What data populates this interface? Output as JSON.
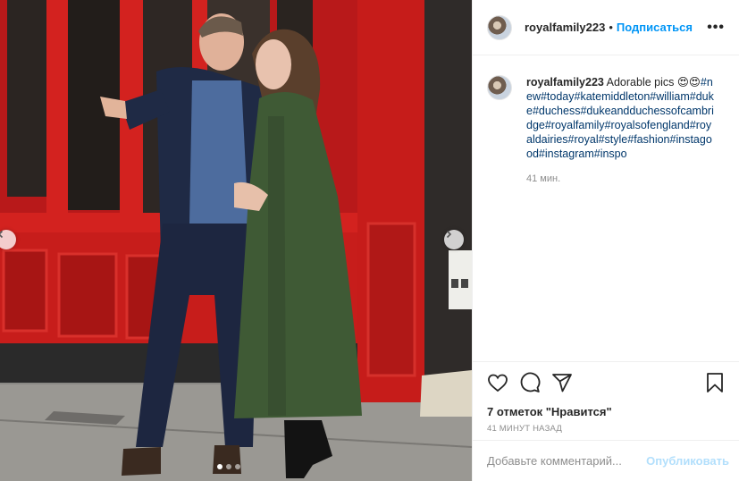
{
  "post": {
    "username": "royalfamily223",
    "separator": "•",
    "follow_label": "Подписаться",
    "more_label": "•••"
  },
  "caption": {
    "username": "royalfamily223",
    "text": " Adorable pics 😍😍",
    "hashtags": "#new#today#katemiddleton#william#duke#duchess#dukeandduchessofcambridge#royalfamily#royalsofengland#royaldairies#royal#style#fashion#instagood#instagram#inspo",
    "time": "41 мин."
  },
  "photo": {
    "carousel_dots": 3,
    "active_dot": 0
  },
  "actions": {
    "like_icon": "heart-icon",
    "comment_icon": "comment-icon",
    "share_icon": "share-icon",
    "save_icon": "bookmark-icon",
    "likes_text": "7 отметок \"Нравится\"",
    "posted_text": "41 МИНУТ НАЗАД"
  },
  "comment": {
    "placeholder": "Добавьте комментарий...",
    "publish_label": "Опубликовать"
  },
  "colors": {
    "accent": "#0095f6",
    "publish_disabled": "#b2dffc",
    "hashtag": "#00376b",
    "muted": "#8e8e8e"
  }
}
